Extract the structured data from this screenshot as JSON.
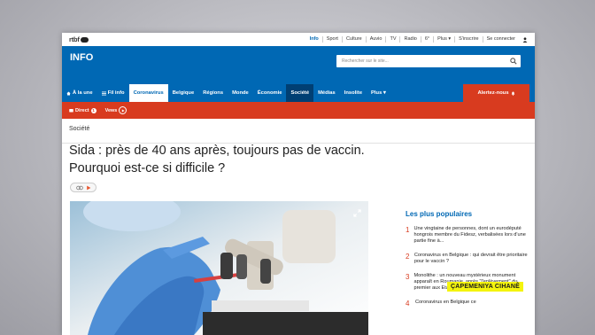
{
  "topbar": {
    "logo": "rtbf",
    "links": [
      "Info",
      "Sport",
      "Culture",
      "Auvio",
      "TV",
      "Radio",
      "6°",
      "Plus ▾",
      "S'inscrire",
      "Se connecter"
    ]
  },
  "header": {
    "title": "INFO",
    "search_placeholder": "Rechercher sur le site...",
    "nav": [
      "À la une",
      "Fil info",
      "Coronavirus",
      "Belgique",
      "Régions",
      "Monde",
      "Économie",
      "Société",
      "Médias",
      "Insolite",
      "Plus ▾"
    ],
    "alert_label": "Alertez-nous"
  },
  "redbar": {
    "direct": "Direct",
    "direct_badge": "1",
    "vews": "Vews"
  },
  "section": "Société",
  "headline": "Sida : près de 40 ans après, toujours pas de vaccin. Pourquoi est-ce si difficile ?",
  "aside": {
    "title": "Les plus populaires",
    "items": [
      {
        "n": "1",
        "text": "Une vingtaine de personnes, dont un eurodéputé hongrois membre du Fidesz, verbalisées lors d'une partie fine à..."
      },
      {
        "n": "2",
        "text": "Coronavirus en Belgique : qui devrait être prioritaire pour le vaccin ?"
      },
      {
        "n": "3",
        "text": "Monolithe : un nouveau mystérieux monument apparaît en Roumanie, après \"l'enlèvement\" du premier aux Etats-Unis"
      },
      {
        "n": "4",
        "text": "Coronavirus en Belgique ce"
      }
    ]
  },
  "caption": "ÇAPEMENIYA CIHANÊ",
  "colors": {
    "brand_blue": "#0068b4",
    "accent_red": "#d83b1f",
    "caption_yellow": "#f4f40e"
  }
}
